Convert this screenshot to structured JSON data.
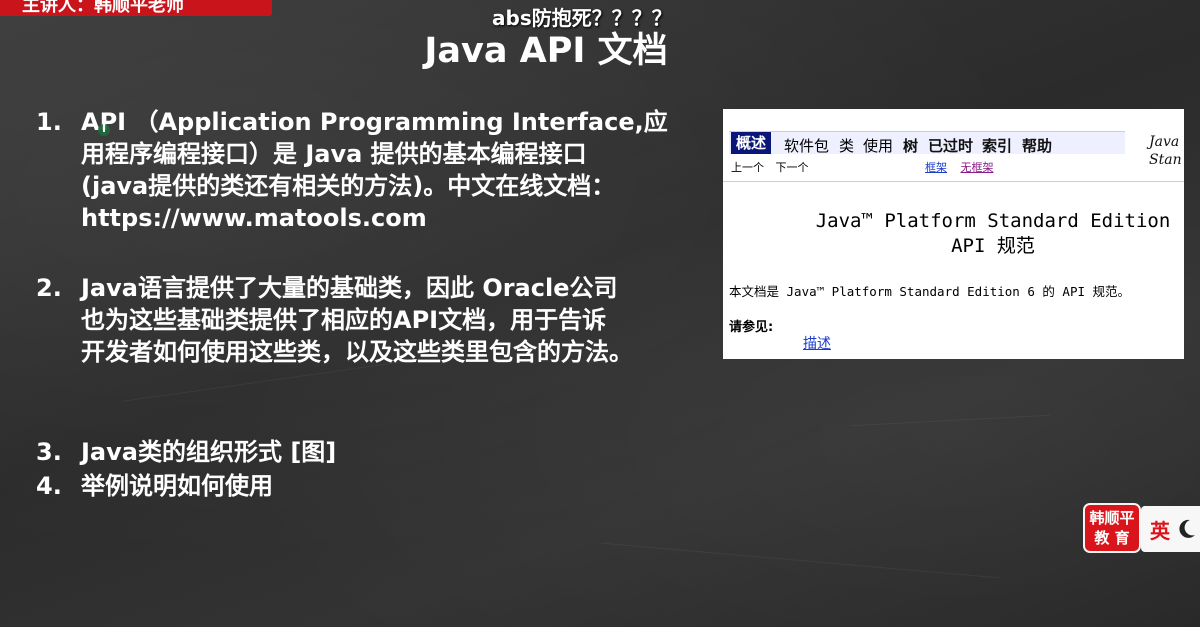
{
  "banner": {
    "text": "主讲人：韩顺平老师"
  },
  "danmaku": {
    "text": "abs防抱死？？？？"
  },
  "slide": {
    "title": "Java API 文档",
    "items": [
      {
        "num": "1.",
        "lines": [
          "API （Application Programming Interface,应",
          "用程序编程接口）是 Java 提供的基本编程接口",
          "(java提供的类还有相关的方法)。中文在线文档：",
          "https://www.matools.com"
        ]
      },
      {
        "num": "2.",
        "lines": [
          "Java语言提供了大量的基础类，因此 Oracle公司",
          "也为这些基础类提供了相应的API文档，用于告诉",
          "开发者如何使用这些类，以及这些类里包含的方法。"
        ]
      },
      {
        "num": "3.",
        "lines": [
          "Java类的组织形式 [图]"
        ]
      },
      {
        "num": "4.",
        "lines": [
          "举例说明如何使用"
        ]
      }
    ]
  },
  "doc": {
    "nav": [
      "概述",
      "软件包",
      "类",
      "使用",
      "树",
      "已过时",
      "索引",
      "帮助"
    ],
    "subnav": [
      "上一个",
      "下一个"
    ],
    "frames": [
      "框架",
      "无框架"
    ],
    "side": [
      "Java",
      "Stan"
    ],
    "title_lines": [
      "Java™ Platform Standard Edition",
      "API 规范"
    ],
    "description": "本文档是 Java™ Platform Standard Edition 6 的 API 规范。",
    "see_also": "请参见:",
    "link": "描述"
  },
  "logo": {
    "line1": "韩顺平",
    "line2": "教 育"
  },
  "ime": {
    "lang": "英"
  },
  "colors": {
    "banner": "#c9141b",
    "nav_active": "#0a1778",
    "logo": "#d9141b"
  }
}
